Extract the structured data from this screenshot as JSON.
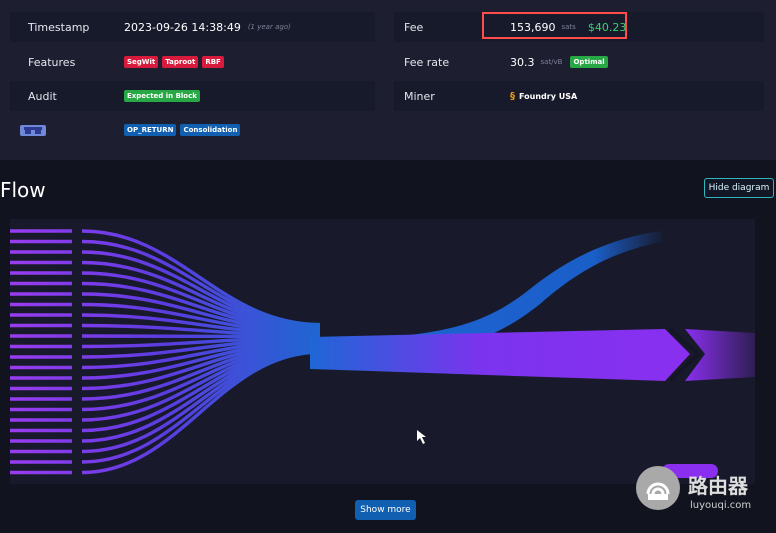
{
  "details": {
    "timestamp": {
      "label": "Timestamp",
      "value": "2023-09-26 14:38:49",
      "relative": "(1 year ago)"
    },
    "fee": {
      "label": "Fee",
      "sats": "153,690",
      "unit": "sats",
      "usd": "$40.23"
    },
    "features": {
      "label": "Features",
      "badges": [
        "SegWit",
        "Taproot",
        "RBF"
      ]
    },
    "fee_rate": {
      "label": "Fee rate",
      "value": "30.3",
      "unit": "sat/vB",
      "badge": "Optimal"
    },
    "audit": {
      "label": "Audit",
      "badge": "Expected in Block"
    },
    "miner": {
      "label": "Miner",
      "name": "Foundry USA"
    },
    "tags": {
      "badges": [
        "OP_RETURN",
        "Consolidation"
      ]
    }
  },
  "flow": {
    "title": "Flow",
    "hide_label": "Hide diagram",
    "show_more_label": "Show more"
  },
  "watermark": {
    "text": "路由器",
    "sub": "luyouqi.com"
  },
  "colors": {
    "accent_blue": "#105fb0",
    "fee_usd": "#3bd16f",
    "highlight": "#ff4d4d",
    "flow_purple": "#8a2ff0"
  }
}
